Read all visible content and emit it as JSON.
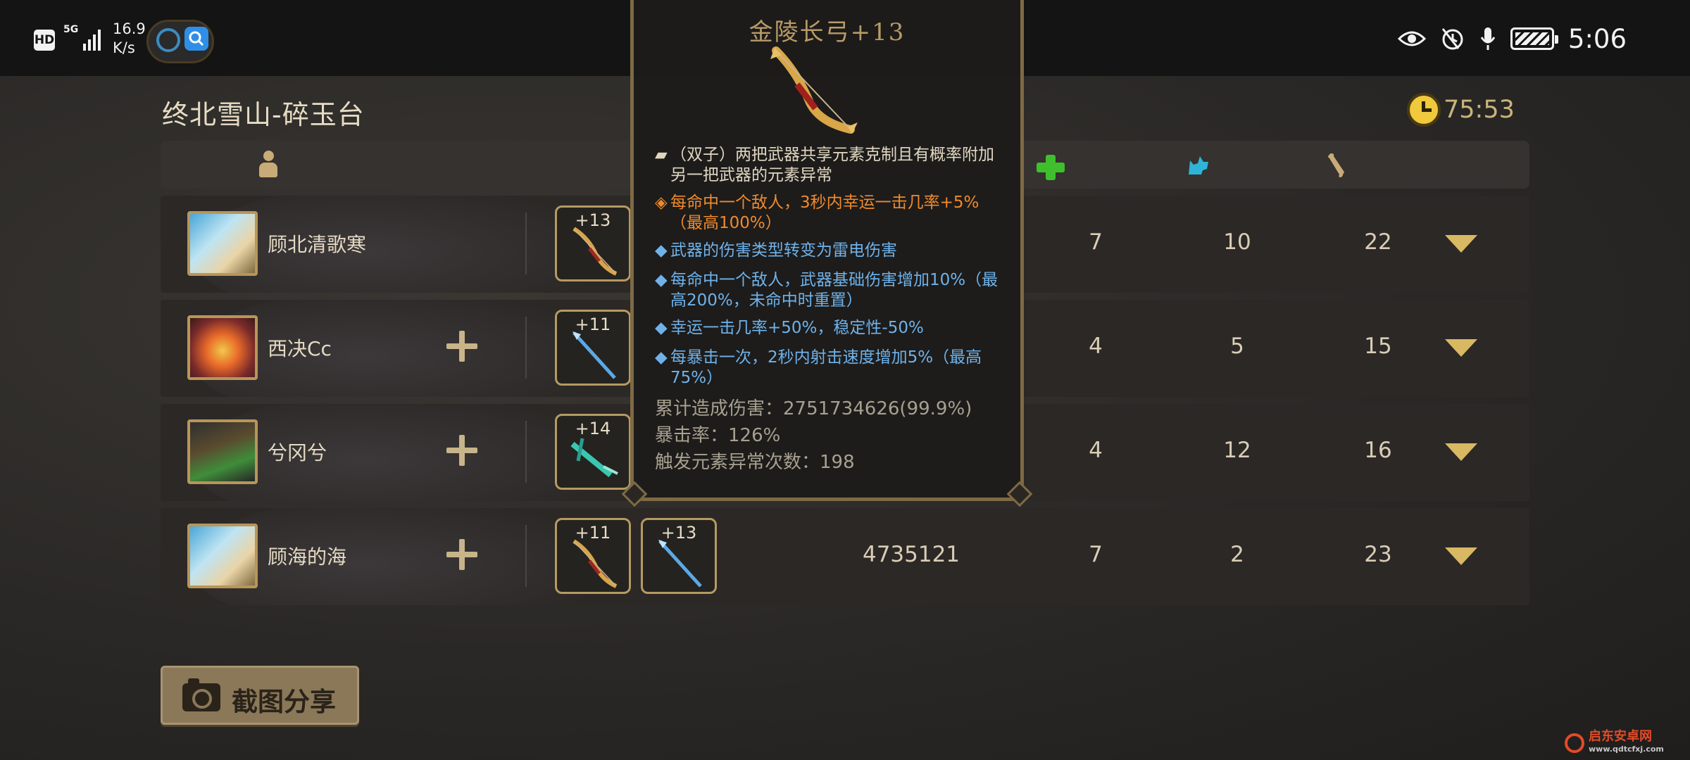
{
  "status_bar": {
    "hd": "HD",
    "network": "5G",
    "speed_value": "16.9",
    "speed_unit": "K/s",
    "time": "5:06"
  },
  "header": {
    "level_name": "终北雪山-碎玉台",
    "timer": "75:53",
    "timer_color": "#f0c93c"
  },
  "columns": {
    "icons": [
      "person-icon",
      "health-cross-icon",
      "cat-icon",
      "bone-icon"
    ]
  },
  "players": [
    {
      "name": "顾北清歌寒",
      "avatar": "blue-beast-avatar",
      "weapons": [
        {
          "level": "+13",
          "type": "bow"
        }
      ],
      "damage": "",
      "a": "7",
      "b": "10",
      "c": "22"
    },
    {
      "name": "西决Cc",
      "avatar": "red-mask-avatar",
      "weapons": [
        {
          "level": "+11",
          "type": "spear"
        }
      ],
      "damage": "",
      "a": "4",
      "b": "5",
      "c": "15"
    },
    {
      "name": "兮冈兮",
      "avatar": "dark-hat-avatar",
      "weapons": [
        {
          "level": "+14",
          "type": "crossbow"
        }
      ],
      "damage": "",
      "a": "4",
      "b": "12",
      "c": "16"
    },
    {
      "name": "顾海的海",
      "avatar": "blue-beast-avatar",
      "weapons": [
        {
          "level": "+11",
          "type": "bow"
        },
        {
          "level": "+13",
          "type": "spear"
        }
      ],
      "damage": "4735121",
      "a": "7",
      "b": "2",
      "c": "23"
    }
  ],
  "tooltip": {
    "title": "金陵长弓+13",
    "lines": [
      {
        "bullet": "▰",
        "text": "（双子）两把武器共享元素克制且有概率附加另一把武器的元素异常",
        "color": "#e0d6c0"
      },
      {
        "bullet": "◈",
        "text": "每命中一个敌人，3秒内幸运一击几率+5%（最高100%）",
        "color": "#f08a2c"
      },
      {
        "bullet": "◆",
        "text": "武器的伤害类型转变为雷电伤害",
        "color": "#6fb2ea"
      },
      {
        "bullet": "◆",
        "text": "每命中一个敌人，武器基础伤害增加10%（最高200%，未命中时重置）",
        "color": "#6fb2ea"
      },
      {
        "bullet": "◆",
        "text": "幸运一击几率+50%，稳定性-50%",
        "color": "#6fb2ea"
      },
      {
        "bullet": "◆",
        "text": "每暴击一次，2秒内射击速度增加5%（最高75%）",
        "color": "#6fb2ea"
      }
    ],
    "stats": {
      "total_damage": "累计造成伤害：2751734626(99.9%)",
      "crit_rate": "暴击率：126%",
      "element_trigger": "触发元素异常次数：198"
    }
  },
  "share_button": {
    "label": "截图分享"
  },
  "watermark": {
    "name": "启东安卓网",
    "url": "www.qdtcfxj.com"
  }
}
